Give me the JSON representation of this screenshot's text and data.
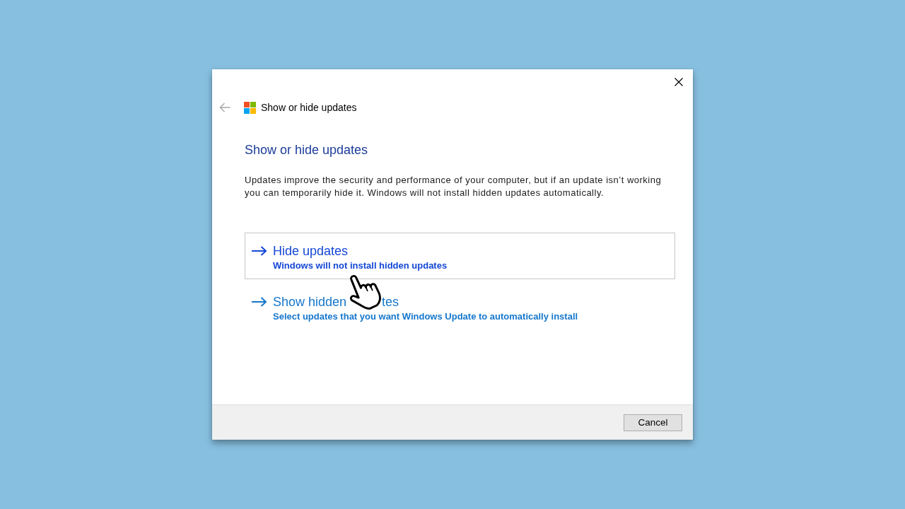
{
  "window": {
    "title": "Show or hide updates",
    "back_button": {
      "disabled": true
    }
  },
  "heading": "Show or hide updates",
  "description": "Updates improve the security and performance of your computer, but if an update isn’t working you can temporarily hide it. Windows will not install hidden updates automatically.",
  "options": [
    {
      "title_parts": [
        "Hide updates"
      ],
      "subtitle": "Windows will not install hidden updates",
      "hovered": true
    },
    {
      "title_parts": [
        "Show hidden",
        "tes"
      ],
      "subtitle": "Select updates that you want Windows Update to automatically install",
      "hovered": false
    }
  ],
  "mouse_pointer": {
    "kind": "hand"
  },
  "footer": {
    "buttons": [
      "Cancel"
    ]
  }
}
